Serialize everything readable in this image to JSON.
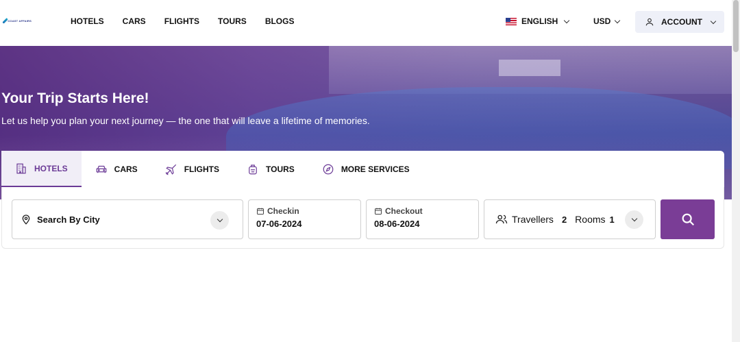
{
  "header": {
    "logo_text": "COAST AFFAIRS",
    "nav": [
      "HOTELS",
      "CARS",
      "FLIGHTS",
      "TOURS",
      "BLOGS"
    ],
    "language": "ENGLISH",
    "currency": "USD",
    "account": "ACCOUNT"
  },
  "hero": {
    "title": "Your Trip Starts Here!",
    "subtitle": "Let us help you plan your next journey — the one that will leave a lifetime of memories."
  },
  "tabs": [
    {
      "label": "HOTELS",
      "icon": "hotel-icon",
      "active": true
    },
    {
      "label": "CARS",
      "icon": "car-icon",
      "active": false
    },
    {
      "label": "FLIGHTS",
      "icon": "plane-icon",
      "active": false
    },
    {
      "label": "TOURS",
      "icon": "bag-icon",
      "active": false
    },
    {
      "label": "MORE SERVICES",
      "icon": "compass-icon",
      "active": false
    }
  ],
  "search": {
    "city_placeholder": "Search By City",
    "checkin_label": "Checkin",
    "checkin_value": "07-06-2024",
    "checkout_label": "Checkout",
    "checkout_value": "08-06-2024",
    "travellers_label": "Travellers",
    "travellers_count": "2",
    "rooms_label": "Rooms",
    "rooms_count": "1"
  },
  "colors": {
    "accent": "#7a3d96",
    "tab_active": "#6b3a96"
  }
}
